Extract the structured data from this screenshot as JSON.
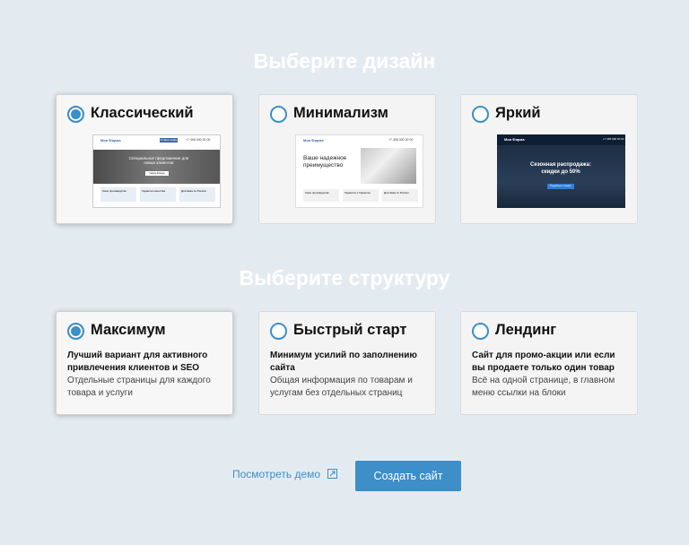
{
  "design": {
    "heading": "Выберите дизайн",
    "options": [
      {
        "title": "Классический",
        "selected": true
      },
      {
        "title": "Минимализм",
        "selected": false
      },
      {
        "title": "Яркий",
        "selected": false
      }
    ],
    "previews": {
      "classic": {
        "logo": "Моя Фирма",
        "phone": "+7 495 000 00 00",
        "header_button": "Оставить заявку",
        "hero": "Специальное предложение для новых клиентов",
        "hero_button": "Узнать больше",
        "features": [
          "Своя производство",
          "Гарантия качества",
          "Доставка по России"
        ]
      },
      "minimal": {
        "logo": "Моя Фирма",
        "phone": "+7 495 000 00 00",
        "hero": "Ваше надежное преимущество",
        "features": [
          "Свое производство",
          "Гарантия и Гарантии",
          "Доставка по России"
        ]
      },
      "bright": {
        "logo": "Моя Фирма",
        "phone": "+7 495 000 00 00",
        "hero": "Сезонная распродажа: скидки до 50%",
        "hero_button": "Подробнее о скидке"
      }
    }
  },
  "structure": {
    "heading": "Выберите структуру",
    "options": [
      {
        "title": "Максимум",
        "strong": "Лучший вариант для активного привлечения клиентов и SEO",
        "desc": "Отдельные страницы для каждого товара и услуги",
        "selected": true
      },
      {
        "title": "Быстрый старт",
        "strong": "Минимум усилий по заполнению сайта",
        "desc": "Общая информация по товарам и услугам без отдельных страниц",
        "selected": false
      },
      {
        "title": "Лендинг",
        "strong": "Сайт для промо-акции или если вы продаете только один товар",
        "desc": "Всё на одной странице, в главном меню ссылки на блоки",
        "selected": false
      }
    ]
  },
  "actions": {
    "demo_label": "Посмотреть демо",
    "create_label": "Создать сайт"
  },
  "colors": {
    "accent": "#3d8ec9",
    "background": "#e4ebf0"
  }
}
